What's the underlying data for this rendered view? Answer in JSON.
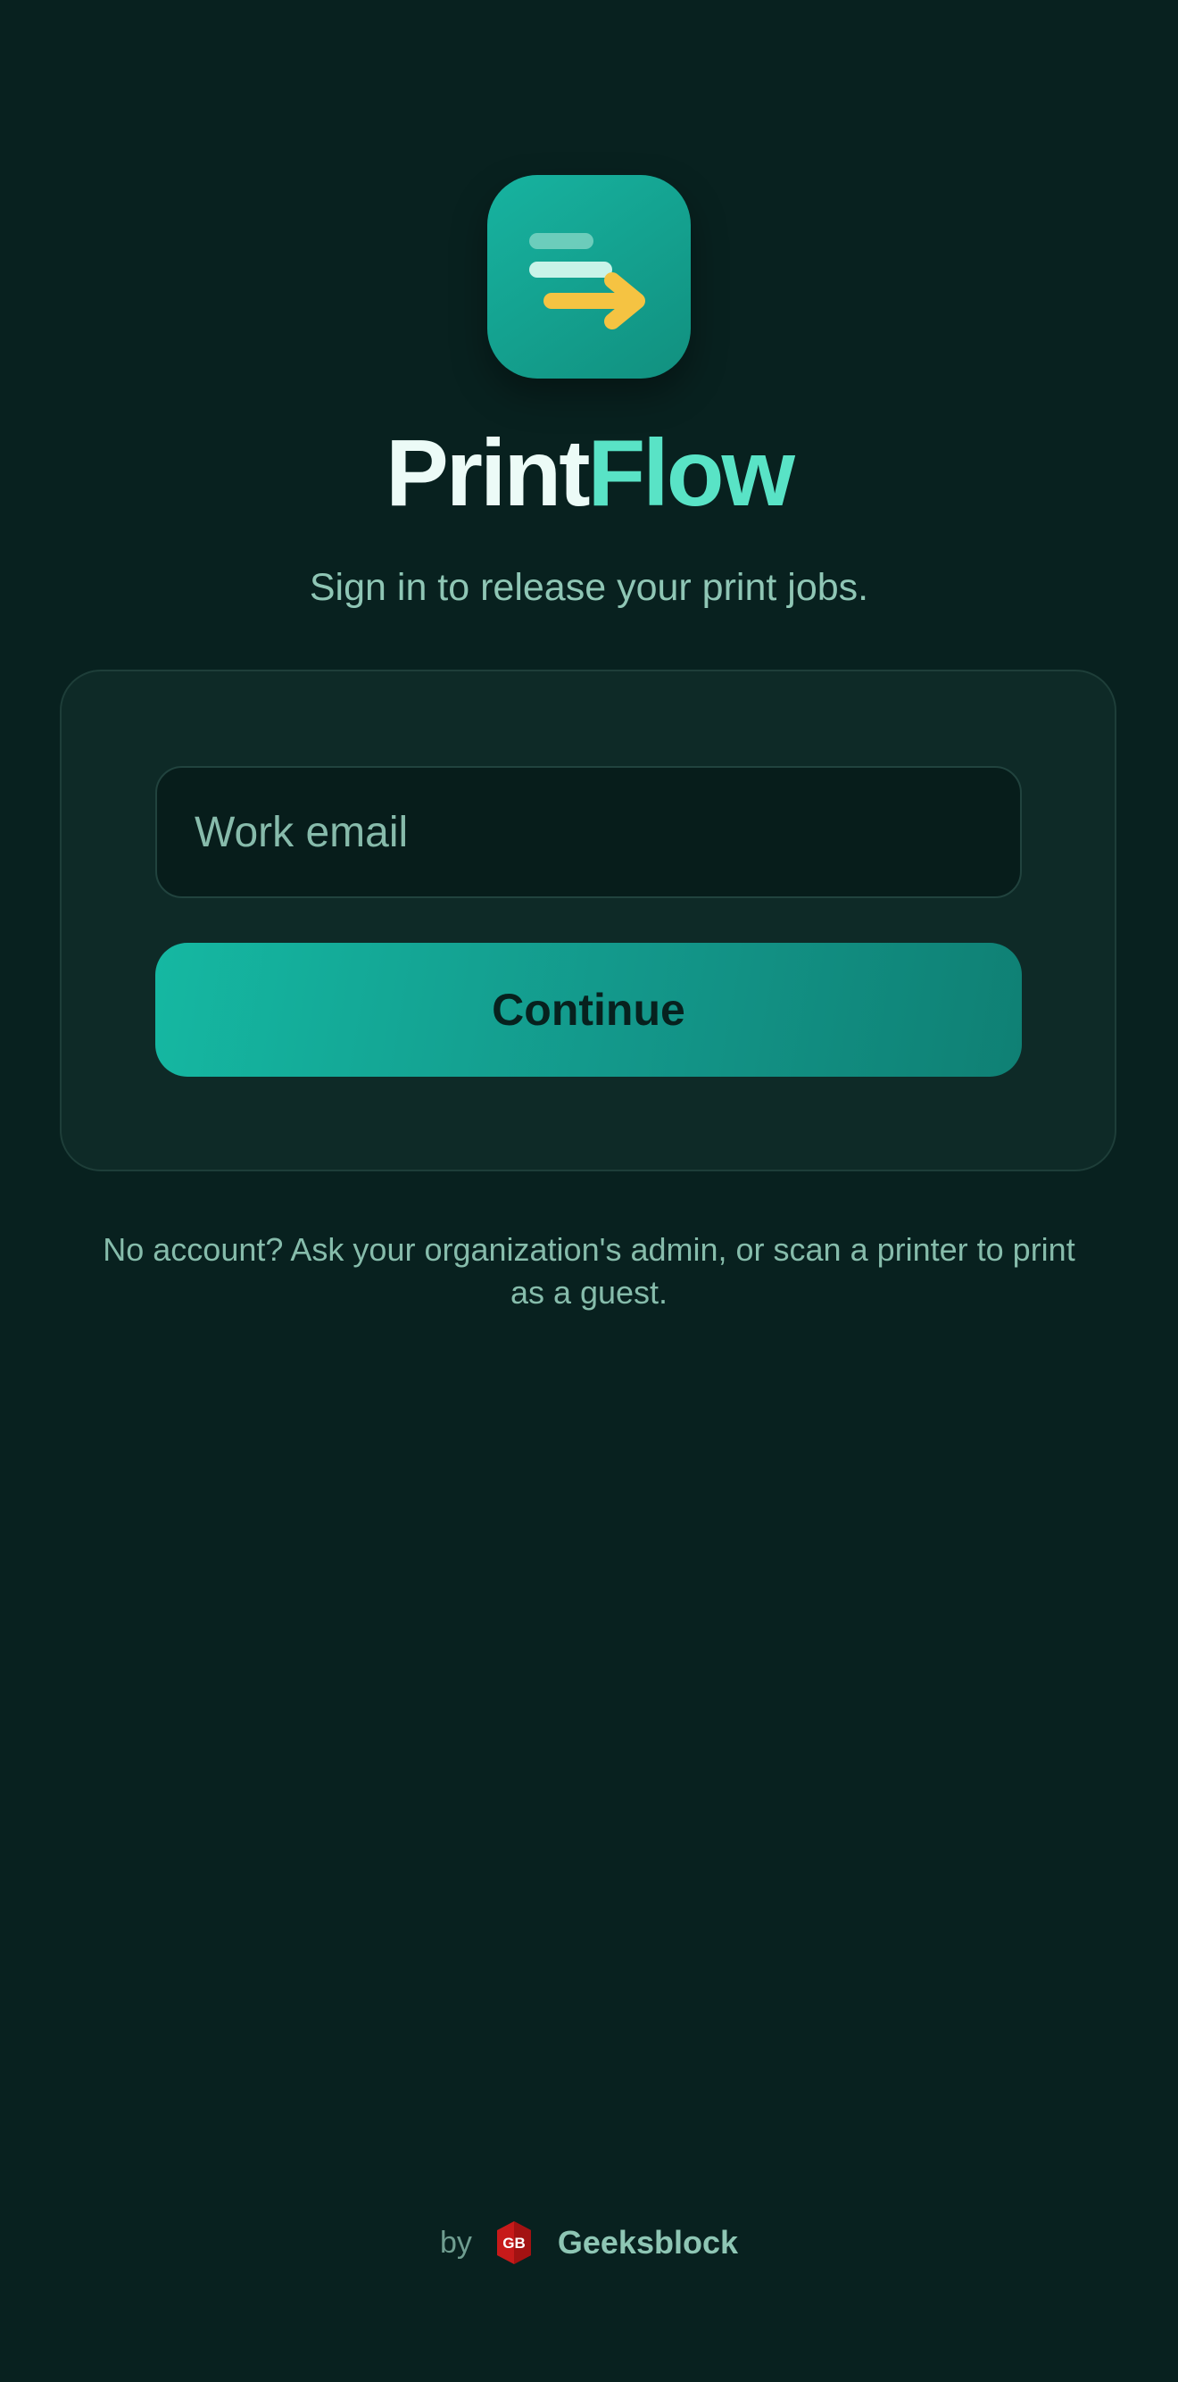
{
  "app": {
    "brand_part1": "Print",
    "brand_part2": "Flow",
    "tagline": "Sign in to release your print jobs.",
    "logo_icon": "print-release-icon"
  },
  "form": {
    "email_placeholder": "Work email",
    "email_value": "",
    "continue_label": "Continue"
  },
  "note": "No account? Ask your organization's admin, or scan a printer to print as a guest.",
  "footer": {
    "by_label": "by",
    "maker_logo_text": "GB",
    "maker_name": "Geeksblock"
  },
  "colors": {
    "background": "#08211f",
    "accent": "#17b3a0",
    "brand_highlight": "#59e3c6",
    "arrow": "#f5c342",
    "maker_logo": "#c71a1a"
  }
}
